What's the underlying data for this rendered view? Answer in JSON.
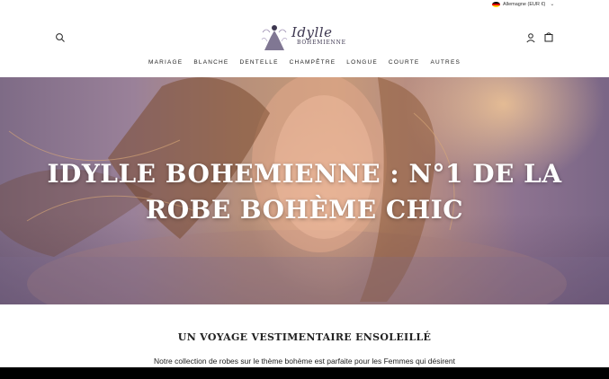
{
  "topbar": {
    "currency_label": "Allemagne (EUR €)",
    "flag_colors": [
      "#000000",
      "#dd0000",
      "#ffce00"
    ]
  },
  "header": {
    "logo": {
      "script": "Idylle",
      "sub": "BOHEMIENNE",
      "color": "#3d3750"
    },
    "icons": [
      "search-icon",
      "user-icon",
      "shopping-bag-icon"
    ]
  },
  "nav": {
    "items": [
      {
        "label": "MARIAGE"
      },
      {
        "label": "BLANCHE"
      },
      {
        "label": "DENTELLE"
      },
      {
        "label": "CHAMPÊTRE"
      },
      {
        "label": "LONGUE"
      },
      {
        "label": "COURTE"
      },
      {
        "label": "AUTRES"
      }
    ]
  },
  "hero": {
    "title_line1": "IDYLLE BOHEMIENNE : N°1 DE LA",
    "title_line2": "ROBE BOHÈME CHIC"
  },
  "section": {
    "heading": "UN VOYAGE VESTIMENTAIRE ENSOLEILLÉ",
    "text": "Notre collection de robes sur le thème bohème est parfaite pour les Femmes qui désirent"
  }
}
